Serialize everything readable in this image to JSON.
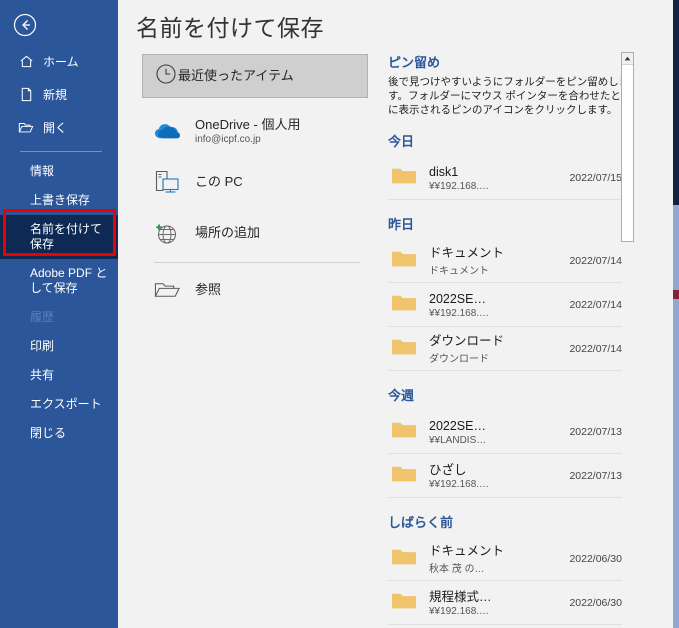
{
  "header": {
    "title": "名前を付けて保存"
  },
  "sidebar": {
    "back_icon": "back-arrow-icon",
    "top_items": [
      {
        "label": "ホーム",
        "icon": "home-icon"
      },
      {
        "label": "新規",
        "icon": "new-document-icon"
      },
      {
        "label": "開く",
        "icon": "open-folder-icon"
      }
    ],
    "items": [
      {
        "label": "情報",
        "state": "normal"
      },
      {
        "label": "上書き保存",
        "state": "normal"
      },
      {
        "label": "名前を付けて保存",
        "state": "selected"
      },
      {
        "label": "Adobe PDF として保存",
        "state": "normal"
      },
      {
        "label": "履歴",
        "state": "disabled"
      },
      {
        "label": "印刷",
        "state": "normal"
      },
      {
        "label": "共有",
        "state": "normal"
      },
      {
        "label": "エクスポート",
        "state": "normal"
      },
      {
        "label": "閉じる",
        "state": "normal"
      }
    ],
    "highlight_color": "#ee0000",
    "background_color": "#2b579a",
    "selected_color": "#0e2a54"
  },
  "places": {
    "selected": {
      "label": "最近使ったアイテム",
      "icon": "clock-icon"
    },
    "items": [
      {
        "label": "OneDrive - 個人用",
        "sub": "info@icpf.co.jp",
        "icon": "onedrive-cloud-icon"
      },
      {
        "label": "この PC",
        "sub": "",
        "icon": "this-pc-icon"
      },
      {
        "label": "場所の追加",
        "sub": "",
        "icon": "add-place-globe-icon"
      },
      {
        "label": "参照",
        "sub": "",
        "icon": "browse-folder-icon"
      }
    ]
  },
  "recent": {
    "pin_title": "ピン留め",
    "pin_description": "後で見つけやすいようにフォルダーをピン留めします。フォルダーにマウス ポインターを合わせたときに表示されるピンのアイコンをクリックします。",
    "groups": [
      {
        "heading": "今日",
        "files": [
          {
            "name": "disk1",
            "path": "¥¥192.168.…",
            "date": "2022/07/15"
          }
        ]
      },
      {
        "heading": "昨日",
        "files": [
          {
            "name": "ドキュメント",
            "path": "ドキュメント",
            "date": "2022/07/14"
          },
          {
            "name": "2022SE…",
            "path": "¥¥192.168.…",
            "date": "2022/07/14"
          },
          {
            "name": "ダウンロード",
            "path": "ダウンロード",
            "date": "2022/07/14"
          }
        ]
      },
      {
        "heading": "今週",
        "files": [
          {
            "name": "2022SE…",
            "path": "¥¥LANDIS…",
            "date": "2022/07/13"
          },
          {
            "name": "ひざし",
            "path": "¥¥192.168.…",
            "date": "2022/07/13"
          }
        ]
      },
      {
        "heading": "しばらく前",
        "files": [
          {
            "name": "ドキュメント",
            "path": "秋本 茂 の…",
            "date": "2022/06/30"
          },
          {
            "name": "規程様式…",
            "path": "¥¥192.168.…",
            "date": "2022/06/30"
          }
        ]
      }
    ]
  },
  "scrollbars": {
    "inner_scroll_icon": "scroll-up-arrow-icon"
  },
  "colors": {
    "accent": "#2b579a",
    "folder": "#f0c36d",
    "highlight": "#ee0000"
  }
}
